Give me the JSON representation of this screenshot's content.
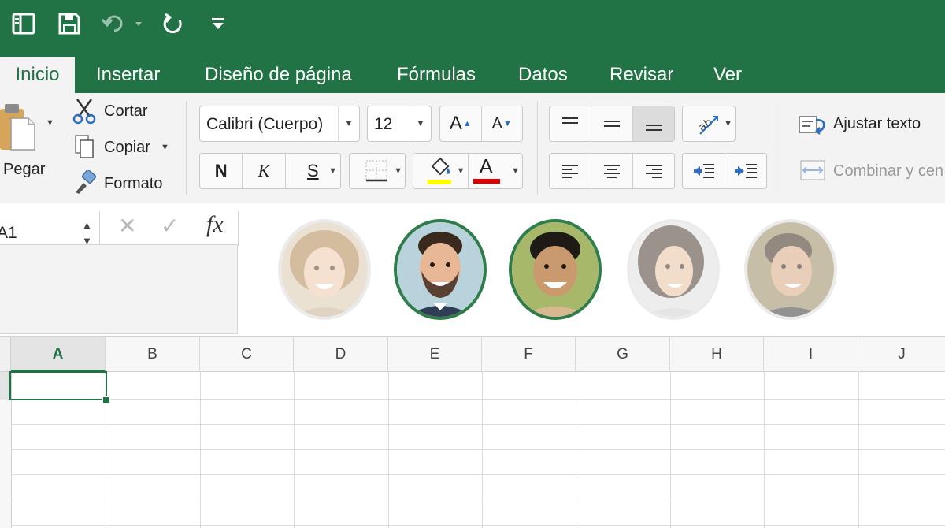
{
  "colors": {
    "brand": "#217346",
    "highlight_bar": "#ffff00",
    "font_color_bar": "#e00000",
    "selected_avatar_border": "#2e7d4a"
  },
  "quick_access": {
    "icons": [
      "sidebar-icon",
      "save-icon",
      "undo-icon",
      "redo-icon",
      "customize-dropdown-icon"
    ]
  },
  "tabs": [
    {
      "label": "Inicio",
      "active": true
    },
    {
      "label": "Insertar"
    },
    {
      "label": "Diseño de página"
    },
    {
      "label": "Fórmulas"
    },
    {
      "label": "Datos"
    },
    {
      "label": "Revisar"
    },
    {
      "label": "Ver"
    }
  ],
  "clipboard": {
    "paste_label": "Pegar",
    "cut_label": "Cortar",
    "copy_label": "Copiar",
    "format_label": "Formato"
  },
  "font": {
    "name": "Calibri (Cuerpo)",
    "size": "12",
    "grow_label": "A",
    "shrink_label": "A",
    "bold_label": "N",
    "italic_label": "K",
    "underline_label": "S",
    "font_color_label": "A"
  },
  "alignment": {
    "wrap_text_label": "Ajustar texto",
    "merge_label": "Combinar y cen"
  },
  "formula_bar": {
    "cell_ref": "A1",
    "cancel_symbol": "✕",
    "enter_symbol": "✓",
    "fx_label": "fx"
  },
  "avatars": [
    {
      "name": "avatar-woman-1",
      "active": false
    },
    {
      "name": "avatar-man-beard",
      "active": true
    },
    {
      "name": "avatar-man-smiling",
      "active": true
    },
    {
      "name": "avatar-woman-2",
      "active": false
    },
    {
      "name": "avatar-man-2",
      "active": false
    }
  ],
  "sheet": {
    "columns": [
      "A",
      "B",
      "C",
      "D",
      "E",
      "F",
      "G",
      "H",
      "I",
      "J"
    ],
    "selected_cell": "A1"
  }
}
